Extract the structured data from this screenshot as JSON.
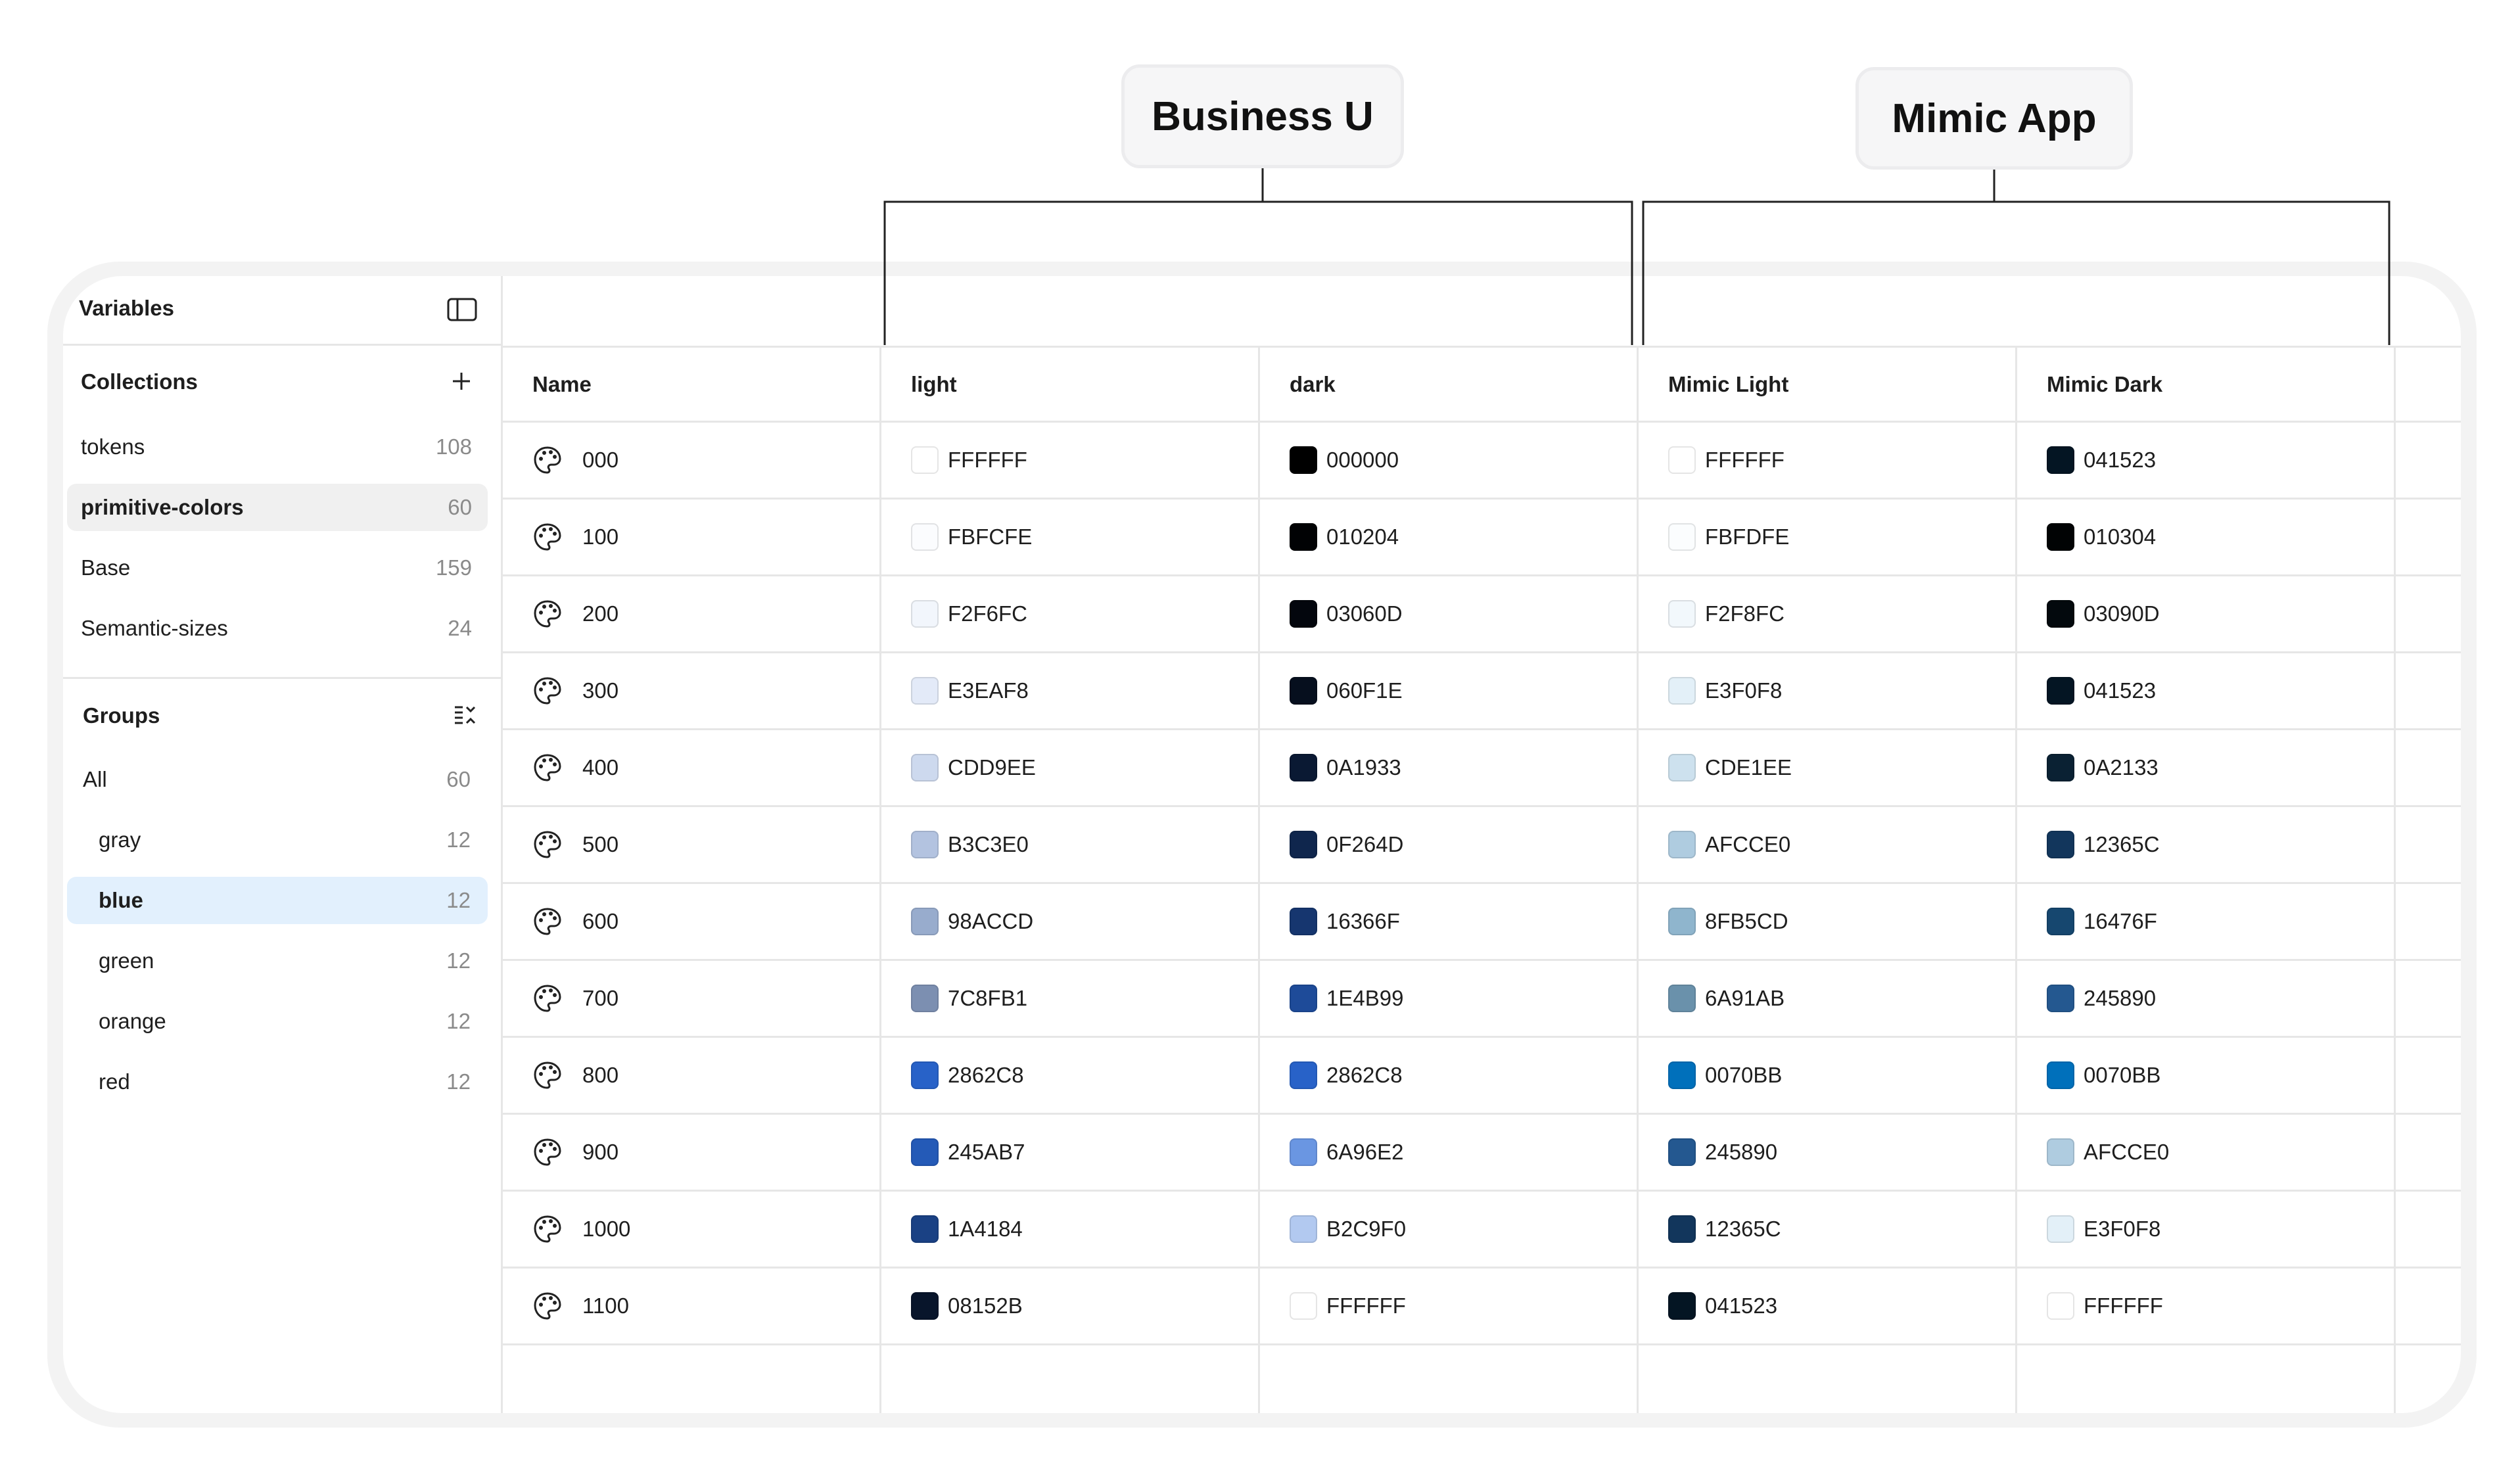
{
  "callouts": {
    "business": "Business U",
    "mimic": "Mimic App"
  },
  "sidebar": {
    "title": "Variables",
    "collections_label": "Collections",
    "collections": [
      {
        "label": "tokens",
        "count": "108"
      },
      {
        "label": "primitive-colors",
        "count": "60"
      },
      {
        "label": "Base",
        "count": "159"
      },
      {
        "label": "Semantic-sizes",
        "count": "24"
      }
    ],
    "groups_label": "Groups",
    "groups": [
      {
        "label": "All",
        "count": "60"
      },
      {
        "label": "gray",
        "count": "12"
      },
      {
        "label": "blue",
        "count": "12"
      },
      {
        "label": "green",
        "count": "12"
      },
      {
        "label": "orange",
        "count": "12"
      },
      {
        "label": "red",
        "count": "12"
      }
    ]
  },
  "table": {
    "columns": [
      "Name",
      "light",
      "dark",
      "Mimic Light",
      "Mimic Dark"
    ],
    "rows": [
      {
        "name": "000",
        "values": [
          "FFFFFF",
          "000000",
          "FFFFFF",
          "041523"
        ]
      },
      {
        "name": "100",
        "values": [
          "FBFCFE",
          "010204",
          "FBFDFE",
          "010304"
        ]
      },
      {
        "name": "200",
        "values": [
          "F2F6FC",
          "03060D",
          "F2F8FC",
          "03090D"
        ]
      },
      {
        "name": "300",
        "values": [
          "E3EAF8",
          "060F1E",
          "E3F0F8",
          "041523"
        ]
      },
      {
        "name": "400",
        "values": [
          "CDD9EE",
          "0A1933",
          "CDE1EE",
          "0A2133"
        ]
      },
      {
        "name": "500",
        "values": [
          "B3C3E0",
          "0F264D",
          "AFCCE0",
          "12365C"
        ]
      },
      {
        "name": "600",
        "values": [
          "98ACCD",
          "16366F",
          "8FB5CD",
          "16476F"
        ]
      },
      {
        "name": "700",
        "values": [
          "7C8FB1",
          "1E4B99",
          "6A91AB",
          "245890"
        ]
      },
      {
        "name": "800",
        "values": [
          "2862C8",
          "2862C8",
          "0070BB",
          "0070BB"
        ]
      },
      {
        "name": "900",
        "values": [
          "245AB7",
          "6A96E2",
          "245890",
          "AFCCE0"
        ]
      },
      {
        "name": "1000",
        "values": [
          "1A4184",
          "B2C9F0",
          "12365C",
          "E3F0F8"
        ]
      },
      {
        "name": "1100",
        "values": [
          "08152B",
          "FFFFFF",
          "041523",
          "FFFFFF"
        ]
      }
    ]
  }
}
